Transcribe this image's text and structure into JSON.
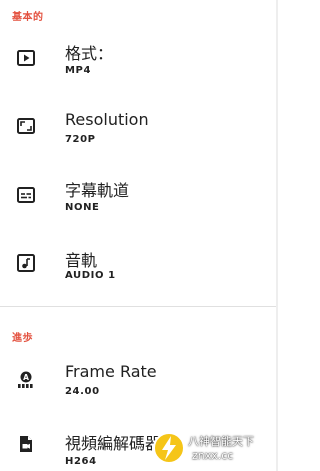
{
  "sections": {
    "basic": {
      "header": "基本的"
    },
    "advanced": {
      "header": "進歩"
    }
  },
  "settings": [
    {
      "title": "格式：",
      "value": "MP4",
      "icon": "video-format-icon"
    },
    {
      "title": "Resolution",
      "value": "720P",
      "icon": "resolution-icon"
    },
    {
      "title": "字幕軌道",
      "value": "NONE",
      "icon": "subtitles-icon"
    },
    {
      "title": "音軌",
      "value": "AUDIO 1",
      "icon": "audio-track-icon"
    },
    {
      "title": "Frame Rate",
      "value": "24.00",
      "icon": "frame-rate-icon"
    },
    {
      "title": "視頻編解碼器",
      "value": "H264",
      "icon": "video-codec-icon"
    }
  ],
  "watermark": {
    "line1": "八神智能天下",
    "line2": "znxx.cc"
  },
  "colors": {
    "section_header": "#e3513f",
    "text": "#212121",
    "divider": "#e0e0e0"
  }
}
